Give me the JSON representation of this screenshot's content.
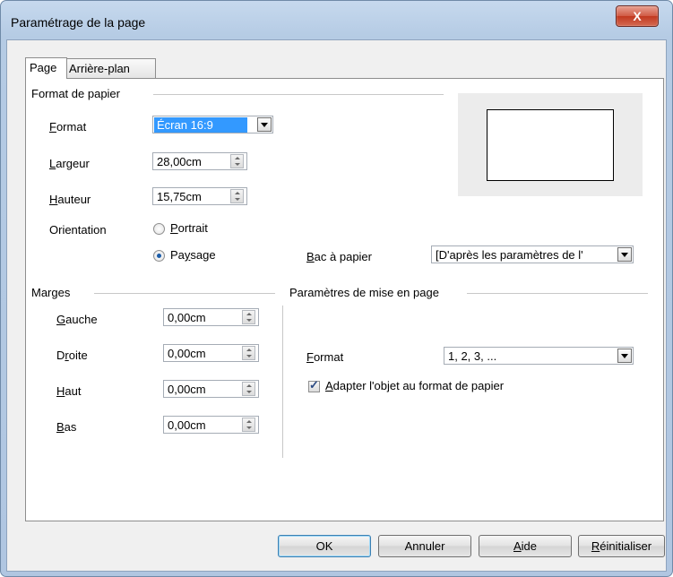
{
  "window": {
    "title": "Paramétrage de la page",
    "close_label": "X"
  },
  "tabs": [
    {
      "label": "Page",
      "active": true
    },
    {
      "label": "Arrière-plan",
      "active": false
    }
  ],
  "paper_format": {
    "heading": "Format de papier",
    "format_label": "Format",
    "format_value": "Écran 16:9",
    "width_label": "Largeur",
    "width_value": "28,00cm",
    "height_label": "Hauteur",
    "height_value": "15,75cm",
    "orientation_label": "Orientation",
    "portrait_label": "Portrait",
    "landscape_label": "Paysage",
    "orientation_selected": "landscape",
    "tray_label": "Bac à papier",
    "tray_value": "[D'après les paramètres de l'"
  },
  "margins": {
    "heading": "Marges",
    "left_label": "Gauche",
    "left_value": "0,00cm",
    "right_label": "Droite",
    "right_value": "0,00cm",
    "top_label": "Haut",
    "top_value": "0,00cm",
    "bottom_label": "Bas",
    "bottom_value": "0,00cm"
  },
  "layout_settings": {
    "heading": "Paramètres de mise en page",
    "format_label": "Format",
    "format_value": "1, 2, 3, ...",
    "fit_label": "Adapter l'objet au format de papier",
    "fit_checked": true
  },
  "buttons": {
    "ok": "OK",
    "cancel": "Annuler",
    "help": "Aide",
    "reset": "Réinitialiser"
  },
  "colors": {
    "selection": "#3399ff",
    "title_bar": "#b9d1ea",
    "close_button": "#c84a33"
  }
}
